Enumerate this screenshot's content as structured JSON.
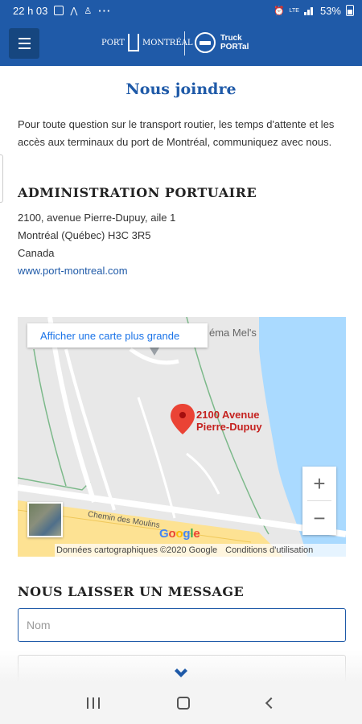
{
  "status_bar": {
    "time": "22 h 03",
    "network": "LTE",
    "battery": "53%",
    "overflow_dots": "···"
  },
  "header": {
    "logo_port": "PORT",
    "logo_montreal": "MONTRÉAL",
    "logo_truck_line1": "Truck",
    "logo_truck_line2": "PORTal"
  },
  "page": {
    "title": "Nous joindre",
    "intro": "Pour toute question sur le transport routier, les temps d'attente et les accès aux terminaux du port de Montréal, communiquez avec nous."
  },
  "admin": {
    "heading": "ADMINISTRATION PORTUAIRE",
    "address_line1": "2100, avenue Pierre-Dupuy, aile 1",
    "address_line2": "Montréal (Québec) H3C 3R5",
    "address_line3": "Canada",
    "website": "www.port-montreal.com"
  },
  "map": {
    "larger_map_link": "Afficher une carte plus grande",
    "poi_label": "éma Mel's",
    "pin_label_line1": "2100 Avenue",
    "pin_label_line2": "Pierre-Dupuy",
    "road_label": "Chemin des Moulins",
    "zoom_in": "+",
    "zoom_out": "−",
    "brand": "Google",
    "attribution": "Données cartographiques ©2020 Google",
    "terms": "Conditions d'utilisation",
    "colors": {
      "land": "#e8e8e8",
      "water": "#aadaff",
      "road": "#ffffff",
      "highway": "#fde293",
      "park_outline": "#7cb98a",
      "pin": "#ea4335"
    }
  },
  "message_form": {
    "heading": "NOUS LAISSER UN MESSAGE",
    "name_placeholder": "Nom"
  },
  "colors": {
    "brand_blue": "#1f5aa8"
  }
}
